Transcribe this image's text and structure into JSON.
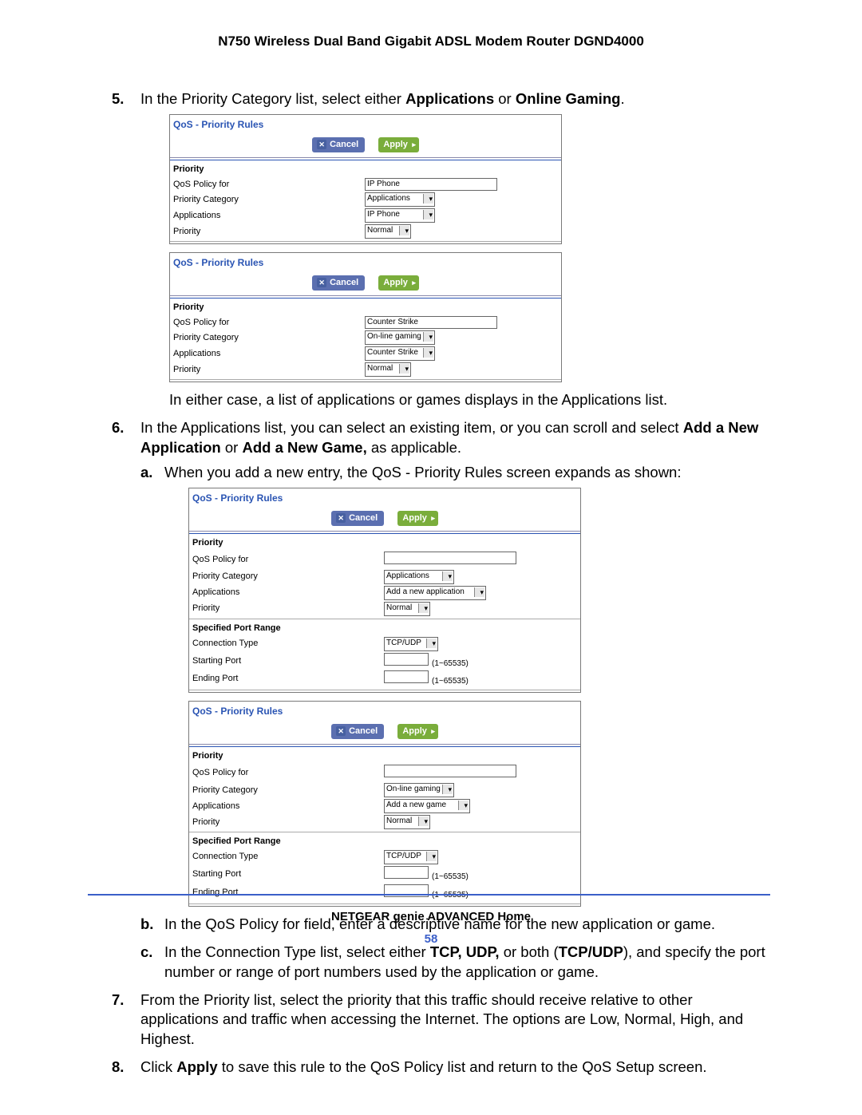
{
  "header": "N750 Wireless Dual Band Gigabit ADSL Modem Router DGND4000",
  "footer": "NETGEAR genie ADVANCED Home",
  "pagenum": "58",
  "labels": {
    "panel_title": "QoS - Priority Rules",
    "cancel": "Cancel",
    "apply": "Apply",
    "priority": "Priority",
    "qos_policy_for": "QoS Policy for",
    "priority_category": "Priority Category",
    "applications": "Applications",
    "priority_lbl": "Priority",
    "spec_port_range": "Specified Port Range",
    "conn_type": "Connection Type",
    "start_port": "Starting Port",
    "end_port": "Ending Port",
    "port_hint": "(1~65535)"
  },
  "vals": {
    "applications_cat": "Applications",
    "online_gaming_cat": "On-line gaming",
    "ipphone": "IP Phone",
    "counter_strike": "Counter Strike",
    "normal": "Normal",
    "add_new_app": "Add a new application",
    "add_new_game": "Add a new game",
    "tcpudp": "TCP/UDP"
  },
  "text": {
    "step5_pre": "In the Priority Category list, select either ",
    "step5_apps": "Applications",
    "step5_or": " or ",
    "step5_og": "Online Gaming",
    "step5_end": ".",
    "after_panels1": "In either case, a list of applications or games displays in the Applications list.",
    "step6_pre": "In the Applications list, you can select an existing item, or you can scroll and select ",
    "step6_b1": "Add a New Application",
    "step6_mid": " or ",
    "step6_b2": "Add a New Game,",
    "step6_end": " as applicable.",
    "step6a": "When you add a new entry, the QoS - Priority Rules screen expands as shown:",
    "step6b": "In the QoS Policy for field, enter a descriptive name for the new application or game.",
    "step6c_pre": "In the Connection Type list, select either ",
    "step6c_b1": "TCP, UDP,",
    "step6c_mid": " or both (",
    "step6c_b2": "TCP/UDP",
    "step6c_end": "), and specify the port number or range of port numbers used by the application or game.",
    "step7": "From the Priority list, select the priority that this traffic should receive relative to other applications and traffic when accessing the Internet. The options are Low, Normal, High, and Highest.",
    "step8_pre": "Click ",
    "step8_b": "Apply",
    "step8_end": " to save this rule to the QoS Policy list and return to the QoS Setup screen."
  }
}
